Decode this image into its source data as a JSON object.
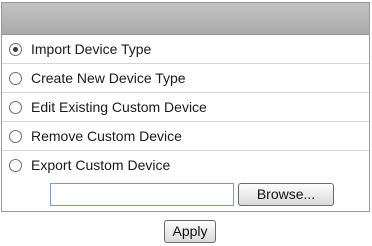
{
  "options": [
    {
      "label": "Import Device Type",
      "checked": true
    },
    {
      "label": "Create New Device Type",
      "checked": false
    },
    {
      "label": "Edit Existing Custom Device",
      "checked": false
    },
    {
      "label": "Remove Custom Device",
      "checked": false
    },
    {
      "label": "Export Custom Device",
      "checked": false
    }
  ],
  "file": {
    "value": "",
    "browse_label": "Browse..."
  },
  "apply_label": "Apply"
}
